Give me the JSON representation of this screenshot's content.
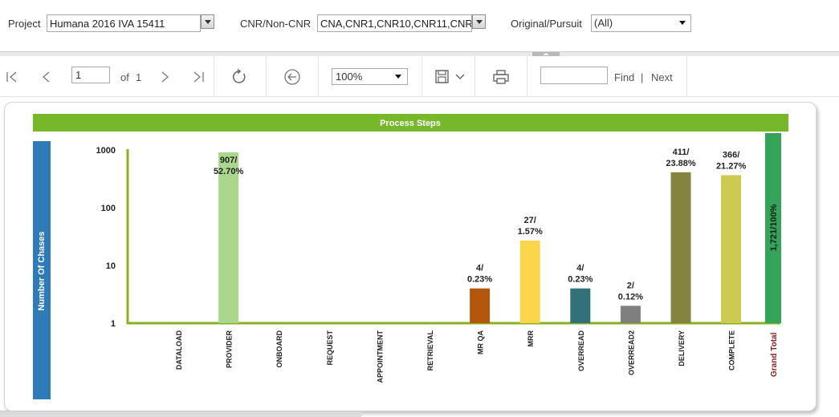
{
  "parameters": {
    "project_label": "Project",
    "project_value": "Humana 2016 IVA 15411",
    "cnr_label": "CNR/Non-CNR",
    "cnr_value": "CNA,CNR1,CNR10,CNR11,CNR1",
    "pursuit_label": "Original/Pursuit",
    "pursuit_value": "(All)"
  },
  "toolbar": {
    "page_value": "1",
    "of_label": "of",
    "total_pages": "1",
    "zoom_value": "100%",
    "find_label": "Find",
    "separator": "|",
    "next_label": "Next",
    "icons": [
      "first-page-icon",
      "previous-page-icon",
      "next-page-icon",
      "last-page-icon",
      "refresh-icon",
      "back-icon",
      "save-icon",
      "print-icon"
    ]
  },
  "chart_data": {
    "type": "bar",
    "title": "Process Steps",
    "ylabel": "Number Of Chases",
    "y_scale": "log",
    "ylim": [
      1,
      1000
    ],
    "y_ticks": [
      "1000",
      "100",
      "10",
      "1"
    ],
    "categories": [
      "DATALOAD",
      "PROVIDER",
      "ONBOARD",
      "REQUEST",
      "APPOINTMENT",
      "RETRIEVAL",
      "MR QA",
      "MRR",
      "OVERREAD",
      "OVERREAD2",
      "DELIVERY",
      "COMPLETE"
    ],
    "values": [
      null,
      907,
      null,
      null,
      null,
      null,
      4,
      27,
      4,
      2,
      411,
      366
    ],
    "data_labels": [
      "",
      "907/\n52.70%",
      "",
      "",
      "",
      "",
      "4/\n0.23%",
      "27/\n1.57%",
      "4/\n0.23%",
      "2/\n0.12%",
      "411/\n23.88%",
      "366/\n21.27%"
    ],
    "bar_colors": [
      "#aad78d",
      "#aad78d",
      "#aad78d",
      "#aad78d",
      "#aad78d",
      "#aad78d",
      "#b5560f",
      "#fbd64a",
      "#33717a",
      "#7f7f7f",
      "#85843e",
      "#cdca52"
    ],
    "grand_total_label": "Grand Total",
    "grand_total_value": "1,721/100%",
    "colors": {
      "title_band": "#77b82a",
      "axis": "#88b022",
      "ylabel_band": "#2e7bb7",
      "grand_total_band": "#33a45a",
      "grand_total_text": "#8b1a1a"
    }
  }
}
